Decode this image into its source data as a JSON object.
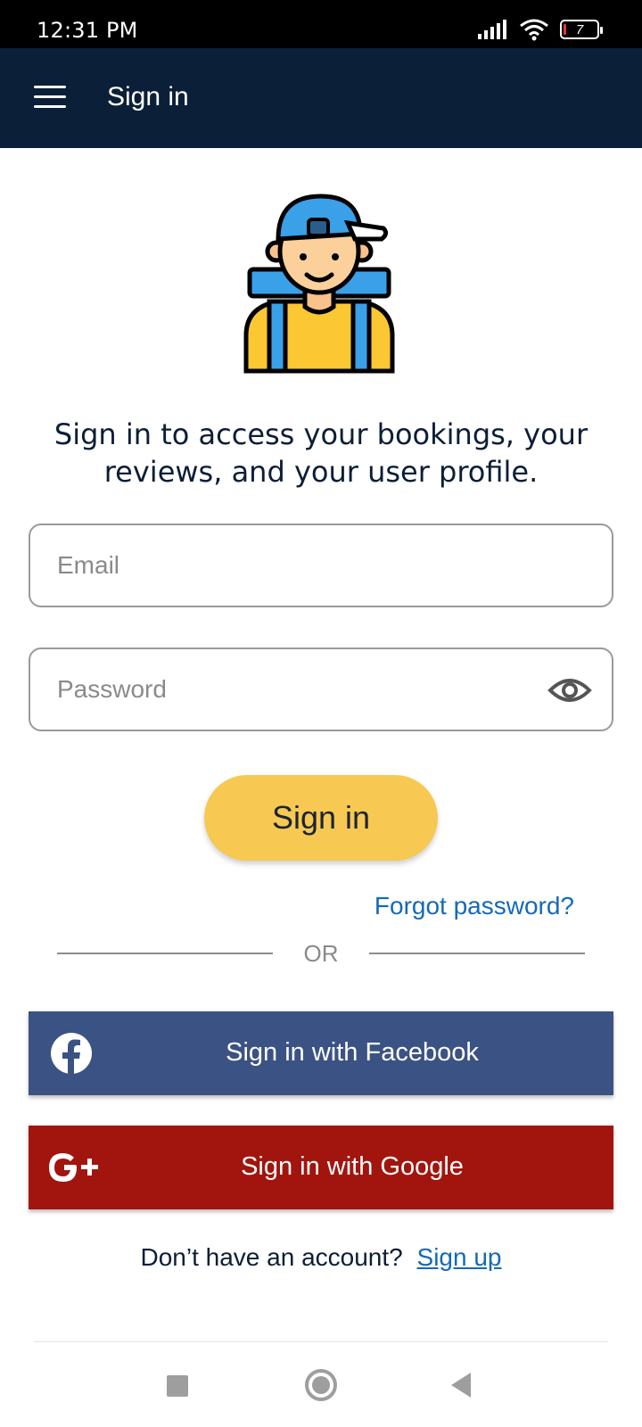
{
  "status_bar": {
    "time": "12:31 PM",
    "battery_level": "7",
    "icons": [
      "signal-icon",
      "wifi-icon",
      "battery-icon"
    ]
  },
  "app_bar": {
    "title": "Sign in",
    "menu_icon": "hamburger-menu-icon",
    "background": "#0b1f38"
  },
  "hero": {
    "illustration": "traveler-backpack-illustration",
    "intro_text": "Sign in to access your bookings, your reviews, and your user profile."
  },
  "form": {
    "email": {
      "placeholder": "Email",
      "value": ""
    },
    "password": {
      "placeholder": "Password",
      "value": "",
      "toggle_icon": "eye-icon"
    },
    "submit_label": "Sign in",
    "submit_color": "#f7c852",
    "forgot_password": "Forgot password?",
    "divider_text": "OR"
  },
  "social": {
    "facebook": {
      "label": "Sign in with Facebook",
      "icon": "facebook-icon",
      "color": "#3b5284"
    },
    "google": {
      "label": "Sign in with Google",
      "icon": "google-plus-icon",
      "color": "#a2150e"
    }
  },
  "signup": {
    "prompt": "Don’t have an account?",
    "link": "Sign up"
  },
  "nav_bar": {
    "buttons": [
      "recents-button",
      "home-button",
      "back-button"
    ]
  },
  "colors": {
    "link": "#1469b8",
    "text": "#0c1e36"
  }
}
